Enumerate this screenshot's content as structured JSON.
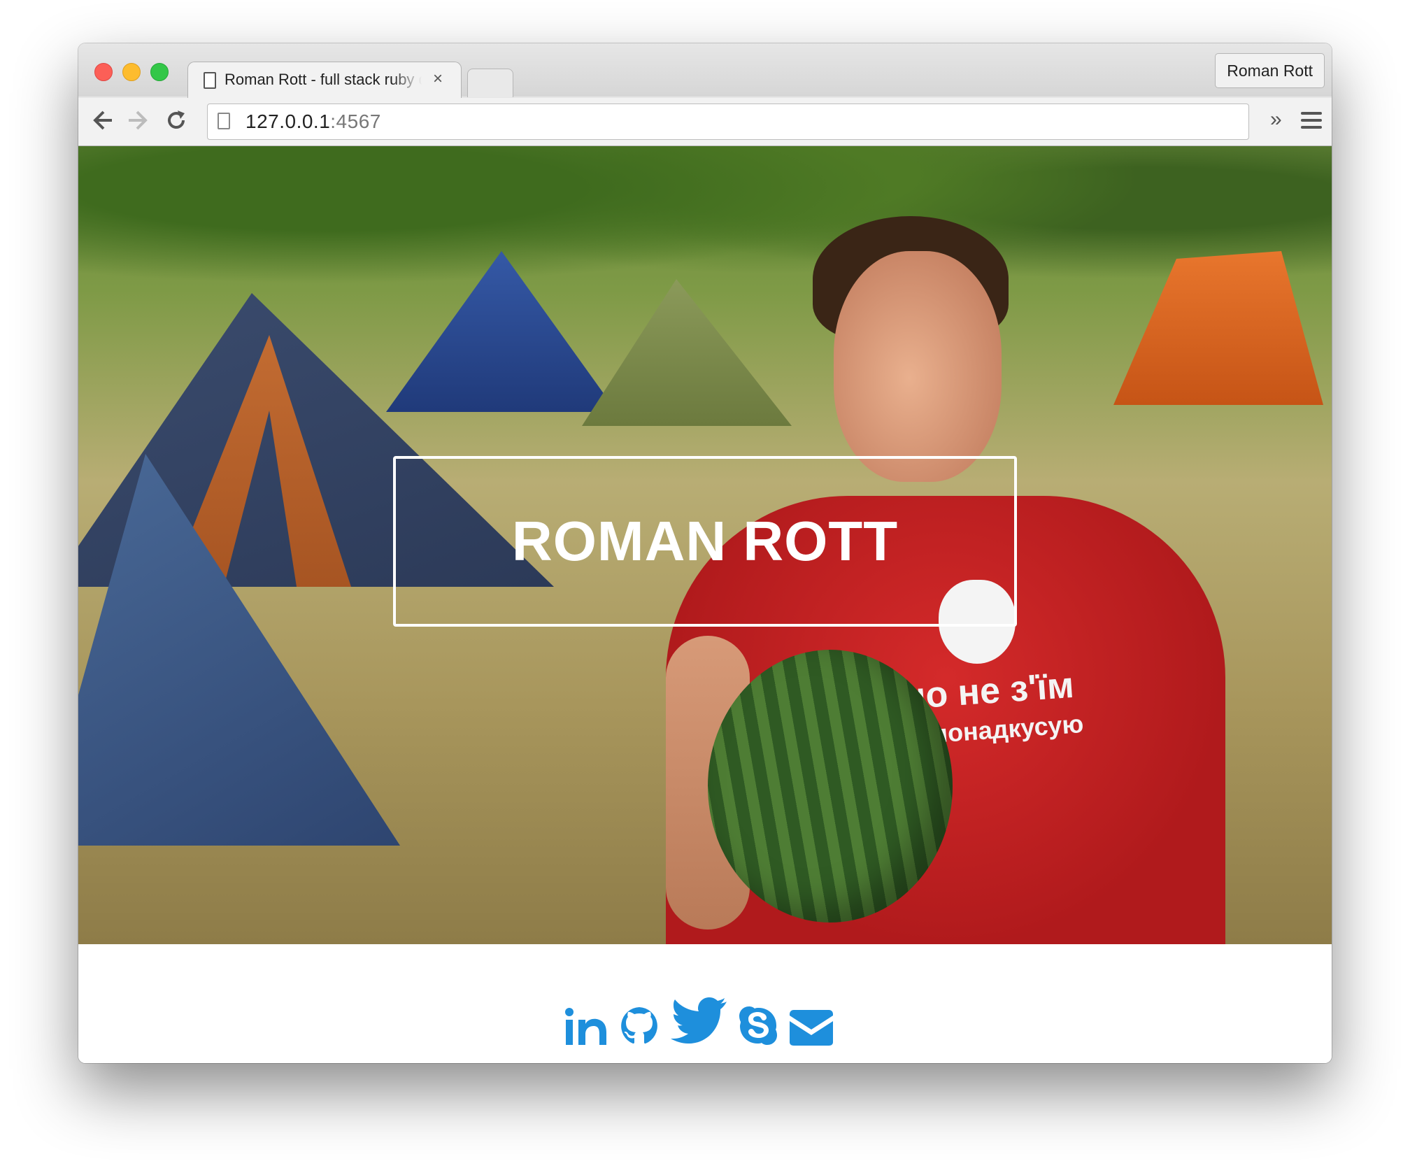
{
  "browser": {
    "tab_title": "Roman Rott - full stack ruby developer",
    "tab_close": "×",
    "profile_name": "Roman Rott",
    "url_host": "127.0.0.1",
    "url_port": ":4567",
    "back_icon": "back-arrow-icon",
    "forward_icon": "forward-arrow-icon",
    "reload_icon": "reload-icon",
    "overflow_label": "»"
  },
  "hero": {
    "title": "ROMAN ROTT",
    "shirt_line1": "що не з'їм",
    "shirt_line2": "то понадкусую"
  },
  "social": {
    "color": "#1e8fdc",
    "links": [
      "linkedin-icon",
      "github-icon",
      "twitter-icon",
      "skype-icon",
      "email-icon"
    ]
  },
  "colors": {
    "traffic_red": "#fc5f57",
    "traffic_yellow": "#fdbc2e",
    "traffic_green": "#33c748"
  }
}
